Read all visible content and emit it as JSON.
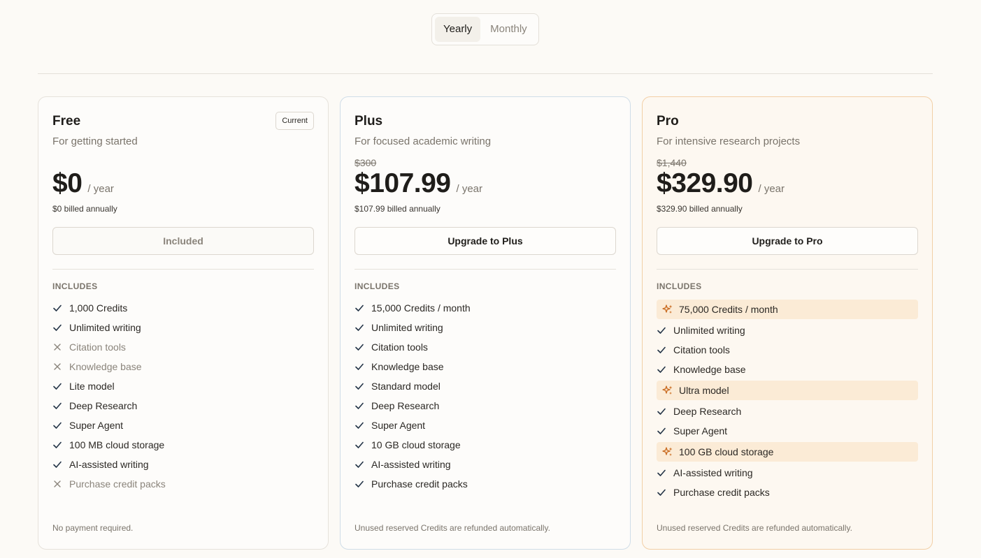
{
  "toggle": {
    "yearly": "Yearly",
    "monthly": "Monthly",
    "selected": "Yearly"
  },
  "plans": [
    {
      "name": "Free",
      "desc": "For getting started",
      "badge": "Current",
      "orig_price": "",
      "price": "$0",
      "per": "/ year",
      "billed": "$0 billed annually",
      "cta": "Included",
      "includes": "INCLUDES",
      "features": [
        {
          "label": "1,000 Credits",
          "state": "check"
        },
        {
          "label": "Unlimited writing",
          "state": "check"
        },
        {
          "label": "Citation tools",
          "state": "x"
        },
        {
          "label": "Knowledge base",
          "state": "x"
        },
        {
          "label": "Lite model",
          "state": "check"
        },
        {
          "label": "Deep Research",
          "state": "check"
        },
        {
          "label": "Super Agent",
          "state": "check"
        },
        {
          "label": "100 MB cloud storage",
          "state": "check"
        },
        {
          "label": "AI-assisted writing",
          "state": "check"
        },
        {
          "label": "Purchase credit packs",
          "state": "x"
        }
      ],
      "footnote": "No payment required."
    },
    {
      "name": "Plus",
      "desc": "For focused academic writing",
      "badge": "",
      "orig_price": "$300",
      "price": "$107.99",
      "per": "/ year",
      "billed": "$107.99 billed annually",
      "cta": "Upgrade to Plus",
      "includes": "INCLUDES",
      "features": [
        {
          "label": "15,000 Credits / month",
          "state": "check"
        },
        {
          "label": "Unlimited writing",
          "state": "check"
        },
        {
          "label": "Citation tools",
          "state": "check"
        },
        {
          "label": "Knowledge base",
          "state": "check"
        },
        {
          "label": "Standard model",
          "state": "check"
        },
        {
          "label": "Deep Research",
          "state": "check"
        },
        {
          "label": "Super Agent",
          "state": "check"
        },
        {
          "label": "10 GB cloud storage",
          "state": "check"
        },
        {
          "label": "AI-assisted writing",
          "state": "check"
        },
        {
          "label": "Purchase credit packs",
          "state": "check"
        }
      ],
      "footnote": "Unused reserved Credits are refunded automatically."
    },
    {
      "name": "Pro",
      "desc": "For intensive research projects",
      "badge": "",
      "orig_price": "$1,440",
      "price": "$329.90",
      "per": "/ year",
      "billed": "$329.90 billed annually",
      "cta": "Upgrade to Pro",
      "includes": "INCLUDES",
      "features": [
        {
          "label": "75,000 Credits / month",
          "state": "highlight"
        },
        {
          "label": "Unlimited writing",
          "state": "check"
        },
        {
          "label": "Citation tools",
          "state": "check"
        },
        {
          "label": "Knowledge base",
          "state": "check"
        },
        {
          "label": "Ultra model",
          "state": "highlight"
        },
        {
          "label": "Deep Research",
          "state": "check"
        },
        {
          "label": "Super Agent",
          "state": "check"
        },
        {
          "label": "100 GB cloud storage",
          "state": "highlight"
        },
        {
          "label": "AI-assisted writing",
          "state": "check"
        },
        {
          "label": "Purchase credit packs",
          "state": "check"
        }
      ],
      "footnote": "Unused reserved Credits are refunded automatically."
    }
  ],
  "colors": {
    "accent": "#d98a3d",
    "check": "#243447",
    "highlight_bg": "#fbebd6"
  }
}
